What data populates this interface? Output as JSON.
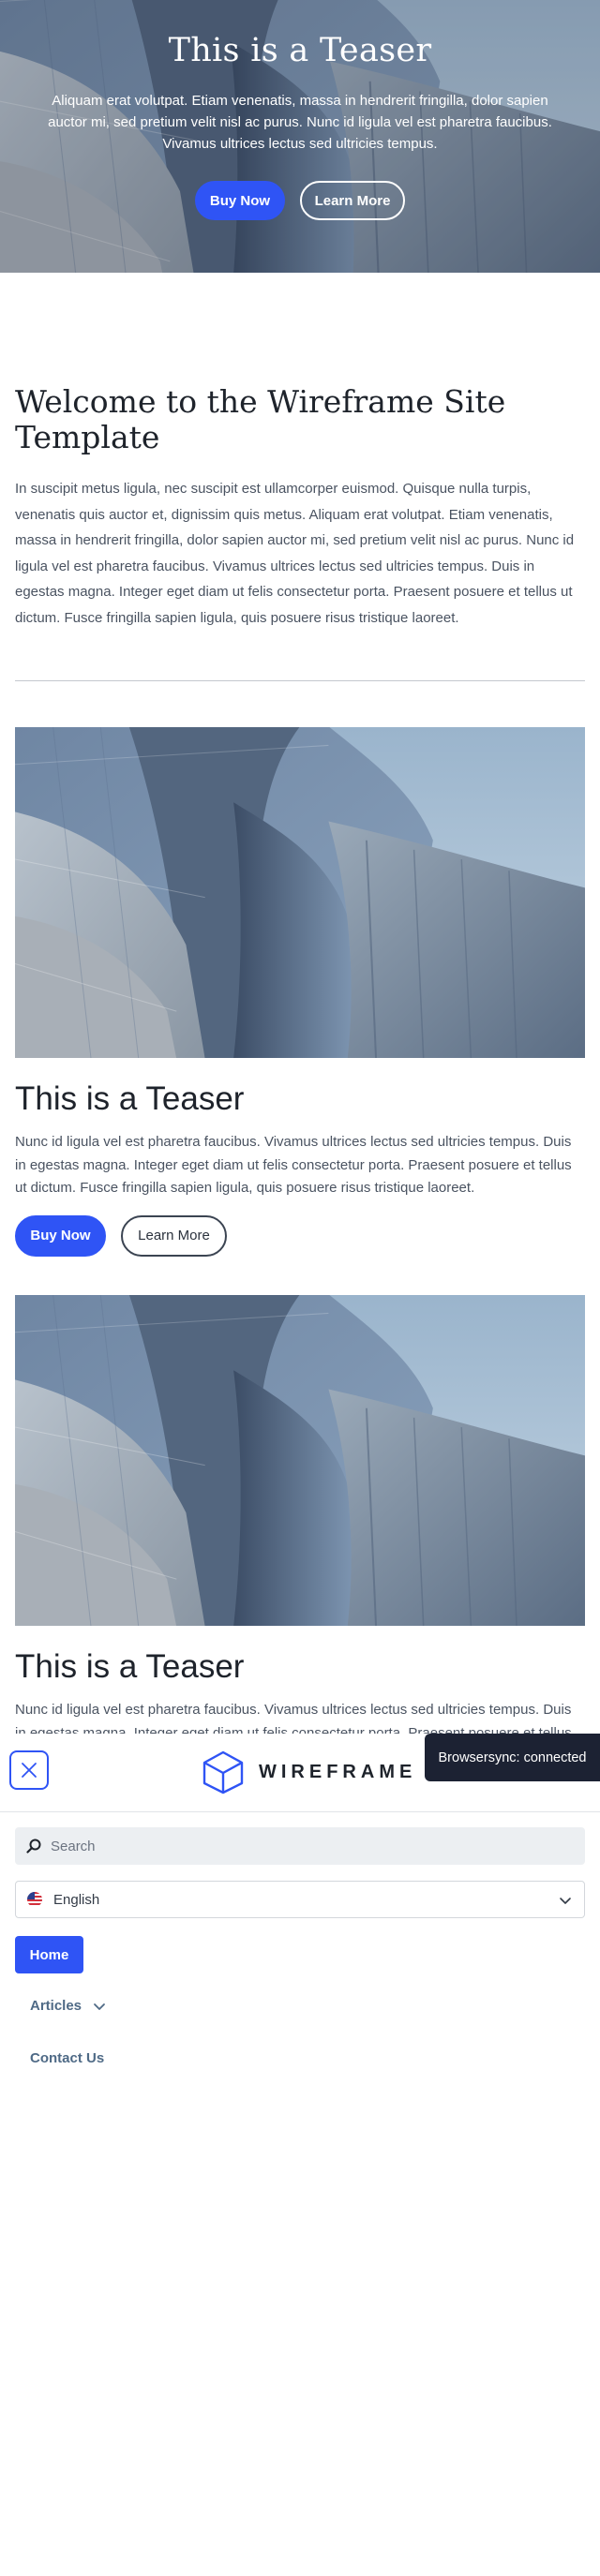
{
  "hero": {
    "title": "This is a Teaser",
    "text": "Aliquam erat volutpat. Etiam venenatis, massa in hendrerit fringilla, dolor sapien auctor mi, sed pretium velit nisl ac purus. Nunc id ligula vel est pharetra faucibus. Vivamus ultrices lectus sed ultricies tempus.",
    "primary_label": "Buy Now",
    "secondary_label": "Learn More"
  },
  "welcome": {
    "title": "Welcome to the Wireframe Site Template",
    "text": "In suscipit metus ligula, nec suscipit est ullamcorper euismod. Quisque nulla turpis, venenatis quis auctor et, dignissim quis metus. Aliquam erat volutpat. Etiam venenatis, massa in hendrerit fringilla, dolor sapien auctor mi, sed pretium velit nisl ac purus. Nunc id ligula vel est pharetra faucibus. Vivamus ultrices lectus sed ultricies tempus. Duis in egestas magna. Integer eget diam ut felis consectetur porta. Praesent posuere et tellus ut dictum. Fusce fringilla sapien ligula, quis posuere risus tristique laoreet."
  },
  "teasers": [
    {
      "title": "This is a Teaser",
      "text": "Nunc id ligula vel est pharetra faucibus. Vivamus ultrices lectus sed ultricies tempus. Duis in egestas magna. Integer eget diam ut felis consectetur porta. Praesent posuere et tellus ut dictum. Fusce fringilla sapien ligula, quis posuere risus tristique laoreet.",
      "primary_label": "Buy Now",
      "secondary_label": "Learn More"
    },
    {
      "title": "This is a Teaser",
      "text": "Nunc id ligula vel est pharetra faucibus. Vivamus ultrices lectus sed ultricies tempus. Duis in egestas magna. Integer eget diam ut felis consectetur porta. Praesent posuere et tellus ut dictum."
    }
  ],
  "menu": {
    "logo_text": "WIREFRAME",
    "search_placeholder": "Search",
    "language": "English",
    "items": [
      {
        "label": "Home",
        "active": true
      },
      {
        "label": "Articles",
        "has_submenu": true
      },
      {
        "label": "Contact Us"
      }
    ]
  },
  "toast": {
    "text": "Browsersync: connected"
  },
  "colors": {
    "accent": "#2f54f5",
    "toast_bg": "#1c2233"
  },
  "icons": [
    "close-icon",
    "wireframe-cube-logo",
    "search-icon",
    "us-flag-icon",
    "chevron-down-icon"
  ]
}
